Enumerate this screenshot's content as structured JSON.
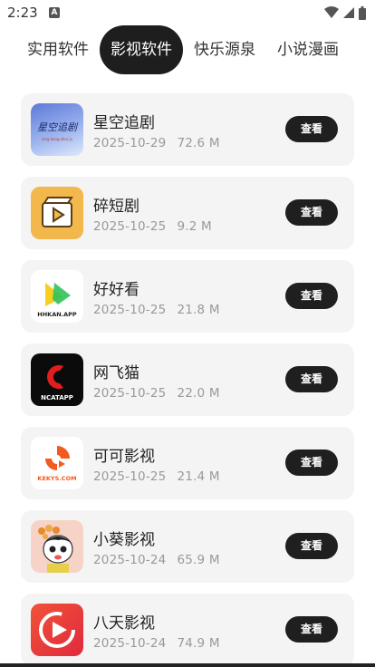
{
  "status_bar": {
    "time": "2:23",
    "notif_badge": "A"
  },
  "tabs": [
    {
      "label": "实用软件"
    },
    {
      "label": "影视软件"
    },
    {
      "label": "快乐源泉"
    },
    {
      "label": "小说漫画"
    }
  ],
  "active_tab_index": 1,
  "view_label": "查看",
  "apps": [
    {
      "name": "星空追剧",
      "date": "2025-10-29",
      "size": "72.6 M",
      "icon_text": "星空追剧",
      "icon_sub": "xing kong zhui ju"
    },
    {
      "name": "碎短剧",
      "date": "2025-10-25",
      "size": "9.2 M"
    },
    {
      "name": "好好看",
      "date": "2025-10-25",
      "size": "21.8 M",
      "icon_text": "HHKAN.APP"
    },
    {
      "name": "网飞猫",
      "date": "2025-10-25",
      "size": "22.0 M",
      "icon_text": "NCATAPP"
    },
    {
      "name": "可可影视",
      "date": "2025-10-25",
      "size": "21.4 M",
      "icon_text": "KEKYS.COM"
    },
    {
      "name": "小葵影视",
      "date": "2025-10-24",
      "size": "65.9 M"
    },
    {
      "name": "八天影视",
      "date": "2025-10-24",
      "size": "74.9 M"
    }
  ]
}
